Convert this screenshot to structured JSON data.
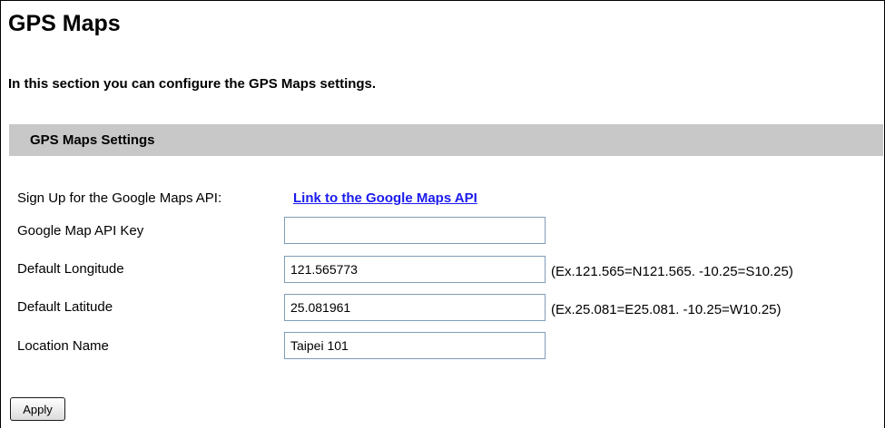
{
  "page": {
    "title": "GPS Maps",
    "description": "In this section you can configure the GPS Maps settings."
  },
  "section": {
    "title": "GPS Maps Settings"
  },
  "signup": {
    "label": "Sign Up for the Google Maps API:",
    "link_text": "Link to the Google Maps API"
  },
  "fields": {
    "api_key": {
      "label": "Google Map API Key",
      "value": ""
    },
    "longitude": {
      "label": "Default Longitude",
      "value": "121.565773",
      "hint": "(Ex.121.565=N121.565. -10.25=S10.25)"
    },
    "latitude": {
      "label": "Default Latitude",
      "value": "25.081961",
      "hint": "(Ex.25.081=E25.081. -10.25=W10.25)"
    },
    "location": {
      "label": "Location Name",
      "value": "Taipei 101"
    }
  },
  "actions": {
    "apply_label": "Apply"
  },
  "colors": {
    "section_bar": "#c8c8c8",
    "link": "#1a1aee",
    "input_border": "#7f9db9"
  }
}
